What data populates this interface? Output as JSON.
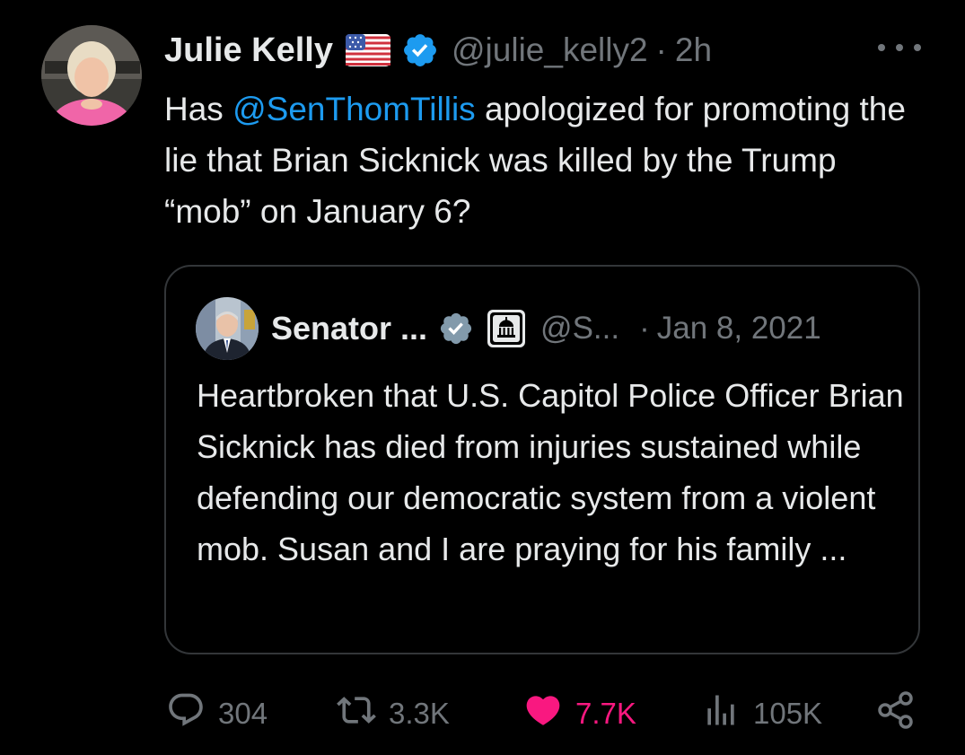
{
  "author": {
    "name": "Julie Kelly",
    "handle": "@julie_kelly2",
    "separator": "·",
    "time": "2h",
    "avatar_icon": "profile-photo"
  },
  "tweet": {
    "text_before": "Has ",
    "mention": "@SenThomTillis",
    "text_after": " apologized for promoting the lie that Brian Sicknick was killed by the Trump “mob” on January 6?"
  },
  "quote": {
    "name": "Senator ...",
    "handle": "@S...",
    "separator": "·",
    "date": "Jan 8, 2021",
    "text": "Heartbroken that U.S. Capitol Police Officer Brian Sicknick has died from injuries sustained while defending our democratic system from a violent mob. Susan and I are praying for his family ..."
  },
  "actions": {
    "replies": "304",
    "reposts": "3.3K",
    "likes": "7.7K",
    "views": "105K"
  },
  "colors": {
    "background": "#000000",
    "text": "#e7e9ea",
    "muted": "#71767b",
    "link": "#1d9bf0",
    "like": "#f91880",
    "verified": "#1d9bf0",
    "border": "#333639"
  }
}
